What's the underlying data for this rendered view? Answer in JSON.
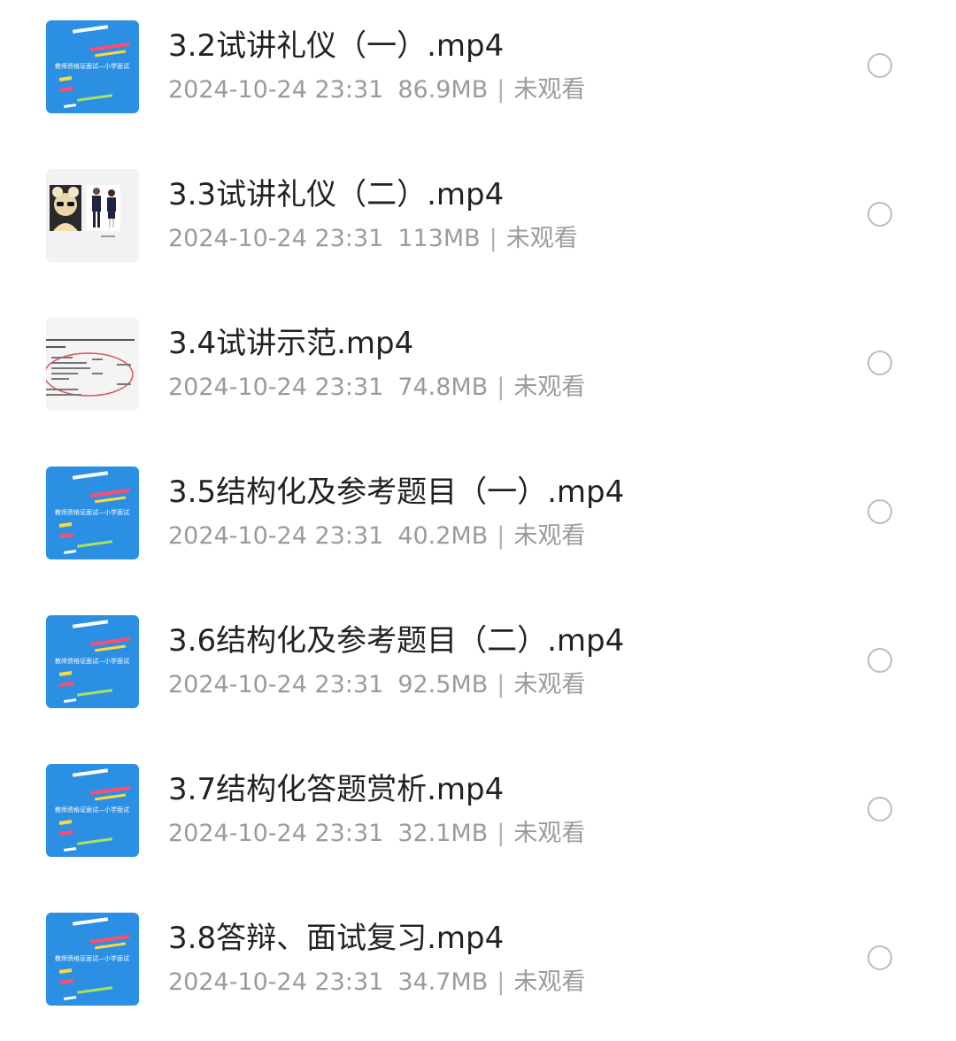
{
  "files": [
    {
      "name": "3.2试讲礼仪（一）.mp4",
      "date": "2024-10-24 23:31",
      "size": "86.9MB",
      "status": "未观看",
      "thumb": "blue"
    },
    {
      "name": "3.3试讲礼仪（二）.mp4",
      "date": "2024-10-24 23:31",
      "size": "113MB",
      "status": "未观看",
      "thumb": "people"
    },
    {
      "name": "3.4试讲示范.mp4",
      "date": "2024-10-24 23:31",
      "size": "74.8MB",
      "status": "未观看",
      "thumb": "document"
    },
    {
      "name": "3.5结构化及参考题目（一）.mp4",
      "date": "2024-10-24 23:31",
      "size": "40.2MB",
      "status": "未观看",
      "thumb": "blue"
    },
    {
      "name": "3.6结构化及参考题目（二）.mp4",
      "date": "2024-10-24 23:31",
      "size": "92.5MB",
      "status": "未观看",
      "thumb": "blue"
    },
    {
      "name": "3.7结构化答题赏析.mp4",
      "date": "2024-10-24 23:31",
      "size": "32.1MB",
      "status": "未观看",
      "thumb": "blue"
    },
    {
      "name": "3.8答辩、面试复习.mp4",
      "date": "2024-10-24 23:31",
      "size": "34.7MB",
      "status": "未观看",
      "thumb": "blue"
    }
  ],
  "thumb_caption": "教师资格证面试—小学面试",
  "colors": {
    "thumb_blue": "#2b8fe3",
    "title_text": "#222222",
    "meta_text": "#9b9b9b",
    "radio_border": "#bdbdbd"
  },
  "icons": {
    "select": "radio-circle-icon"
  },
  "separator": "|"
}
